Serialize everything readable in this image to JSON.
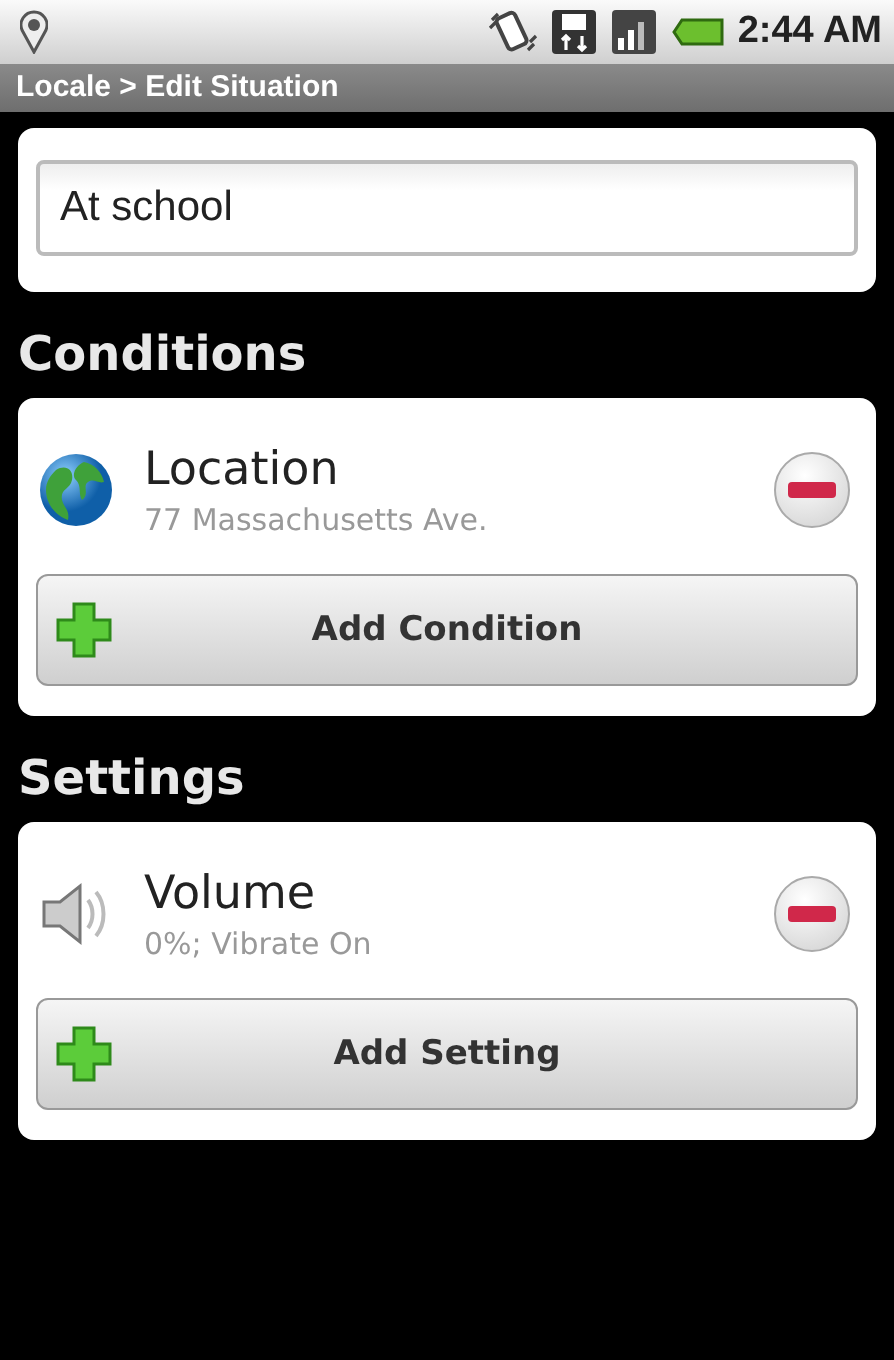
{
  "status_bar": {
    "time": "2:44 AM"
  },
  "window": {
    "title": "Locale > Edit Situation"
  },
  "name_field": {
    "value": "At school"
  },
  "sections": [
    {
      "title": "Conditions",
      "items": [
        {
          "kind": "location",
          "title": "Location",
          "subtitle": "77 Massachusetts Ave."
        }
      ],
      "add_button": "Add Condition"
    },
    {
      "title": "Settings",
      "items": [
        {
          "kind": "volume",
          "title": "Volume",
          "subtitle": "0%; Vibrate On"
        }
      ],
      "add_button": "Add Setting"
    }
  ]
}
